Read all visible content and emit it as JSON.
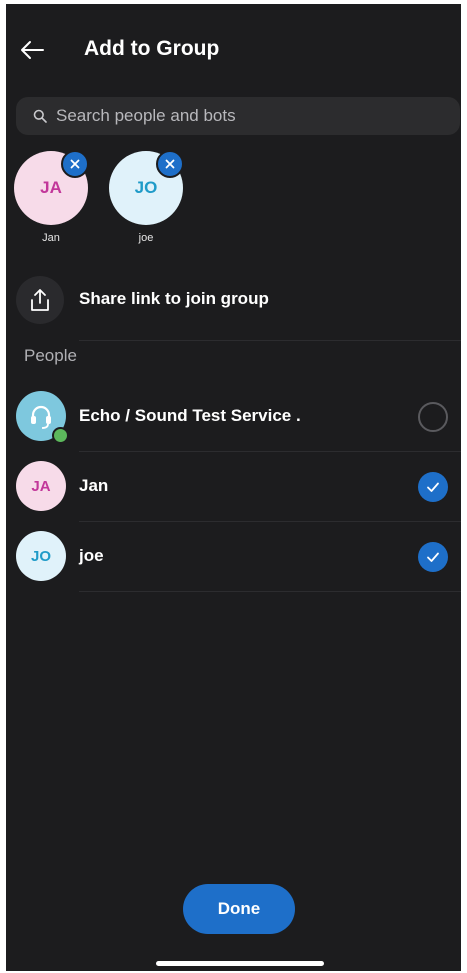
{
  "header": {
    "title": "Add to Group",
    "back_icon": "arrow-left-icon"
  },
  "search": {
    "placeholder": "Search people and bots",
    "value": "",
    "icon": "search-icon"
  },
  "selected": [
    {
      "initials": "JA",
      "name": "Jan",
      "avatar_bg": "#f7dbe9",
      "initials_color": "#c2379a",
      "remove_icon": "close-icon"
    },
    {
      "initials": "JO",
      "name": "joe",
      "avatar_bg": "#e0f2fa",
      "initials_color": "#1f9bc8",
      "remove_icon": "close-icon"
    }
  ],
  "share": {
    "label": "Share link to join group",
    "icon": "share-icon"
  },
  "section_label": "People",
  "people": [
    {
      "name": "Echo / Sound Test Service .",
      "avatar": "headset-icon",
      "avatar_bg": "#7ec8de",
      "online": true,
      "checked": false
    },
    {
      "name": "Jan",
      "initials": "JA",
      "avatar_bg": "#f7dbe9",
      "initials_color": "#c2379a",
      "checked": true
    },
    {
      "name": "joe",
      "initials": "JO",
      "avatar_bg": "#e0f2fa",
      "initials_color": "#1f9bc8",
      "checked": true
    }
  ],
  "done_button": {
    "label": "Done"
  },
  "colors": {
    "background": "#1c1c1e",
    "accent": "#1e6fc9",
    "presence_online": "#5cb85c"
  }
}
